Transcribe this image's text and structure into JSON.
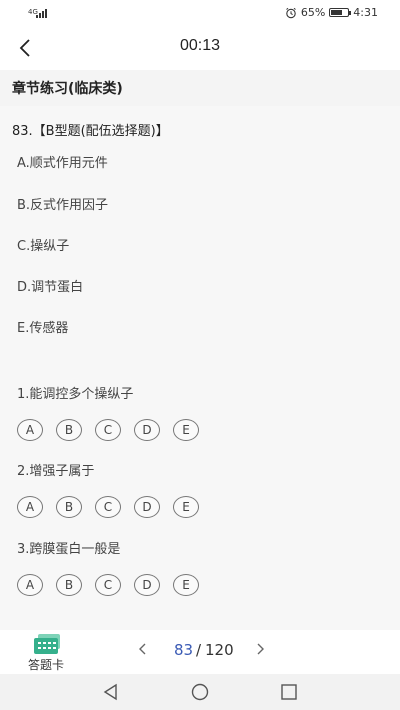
{
  "status_bar": {
    "network": "4G",
    "battery_percent_text": "65%",
    "battery_level": 0.65,
    "time": "4:31"
  },
  "header": {
    "timer": "00:13",
    "back_icon": "chevron-left-icon"
  },
  "section_title": "章节练习(临床类)",
  "question": {
    "title": "83.【B型题(配伍选择题)】",
    "options": [
      "A.顺式作用元件",
      "B.反式作用因子",
      "C.操纵子",
      "D.调节蛋白",
      "E.传感器"
    ],
    "sub_questions": [
      {
        "text": "1.能调控多个操纵子",
        "choices": [
          "A",
          "B",
          "C",
          "D",
          "E"
        ]
      },
      {
        "text": "2.增强子属于",
        "choices": [
          "A",
          "B",
          "C",
          "D",
          "E"
        ]
      },
      {
        "text": "3.跨膜蛋白一般是",
        "choices": [
          "A",
          "B",
          "C",
          "D",
          "E"
        ]
      }
    ]
  },
  "bottom": {
    "answer_card_label": "答题卡",
    "current_page": "83",
    "separator": "/",
    "total_pages": "120",
    "accent": "#3b5bb5",
    "answer_card_icon_color": "#35b08c"
  },
  "nav": {
    "back_icon": "triangle-back-icon",
    "home_icon": "circle-home-icon",
    "recent_icon": "square-recent-icon"
  }
}
